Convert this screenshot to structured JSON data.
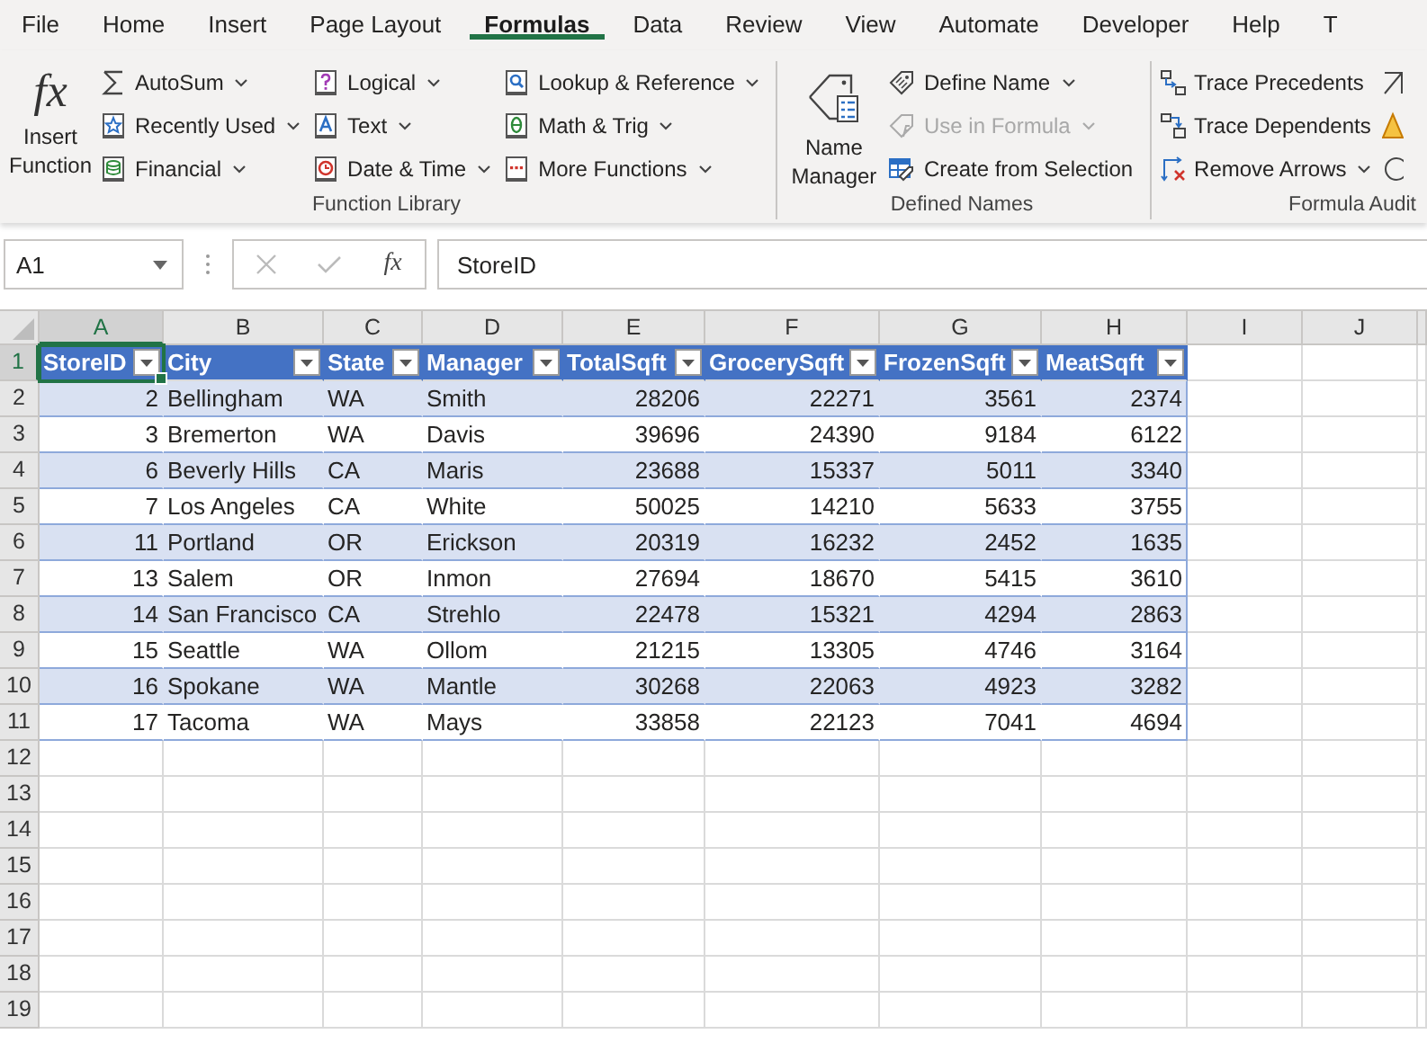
{
  "menu_tabs": [
    {
      "label": "File",
      "selected": false
    },
    {
      "label": "Home",
      "selected": false
    },
    {
      "label": "Insert",
      "selected": false
    },
    {
      "label": "Page Layout",
      "selected": false
    },
    {
      "label": "Formulas",
      "selected": true
    },
    {
      "label": "Data",
      "selected": false
    },
    {
      "label": "Review",
      "selected": false
    },
    {
      "label": "View",
      "selected": false
    },
    {
      "label": "Automate",
      "selected": false
    },
    {
      "label": "Developer",
      "selected": false
    },
    {
      "label": "Help",
      "selected": false
    },
    {
      "label": "T",
      "selected": false
    }
  ],
  "ribbon_groups": [
    {
      "title": "Function Library",
      "large_button": {
        "symbol": "fx",
        "label": "Insert Function"
      },
      "columns": [
        [
          {
            "label": "AutoSum",
            "dropdown": true,
            "disabled": false
          },
          {
            "label": "Recently Used",
            "dropdown": true,
            "disabled": false
          },
          {
            "label": "Financial",
            "dropdown": true,
            "disabled": false
          }
        ],
        [
          {
            "label": "Logical",
            "dropdown": true,
            "disabled": false
          },
          {
            "label": "Text",
            "dropdown": true,
            "disabled": false
          },
          {
            "label": "Date & Time",
            "dropdown": true,
            "disabled": false
          }
        ],
        [
          {
            "label": "Lookup & Reference",
            "dropdown": true,
            "disabled": false
          },
          {
            "label": "Math & Trig",
            "dropdown": true,
            "disabled": false
          },
          {
            "label": "More Functions",
            "dropdown": true,
            "disabled": false
          }
        ]
      ]
    },
    {
      "title": "Defined Names",
      "large_button": {
        "label": "Name Manager"
      },
      "columns": [
        [
          {
            "label": "Define Name",
            "dropdown": true,
            "disabled": false
          },
          {
            "label": "Use in Formula",
            "dropdown": true,
            "disabled": true
          },
          {
            "label": "Create from Selection",
            "dropdown": false,
            "disabled": false
          }
        ]
      ]
    },
    {
      "title": "Formula Audit",
      "columns": [
        [
          {
            "label": "Trace Precedents",
            "dropdown": false,
            "disabled": false
          },
          {
            "label": "Trace Dependents",
            "dropdown": false,
            "disabled": false
          },
          {
            "label": "Remove Arrows",
            "dropdown": true,
            "disabled": false
          }
        ]
      ]
    }
  ],
  "formula_bar": {
    "name_box": "A1",
    "function_symbol": "fx",
    "formula": "StoreID"
  },
  "sheet": {
    "column_headers": [
      {
        "label": "A",
        "selected": true
      },
      {
        "label": "B",
        "selected": false
      },
      {
        "label": "C",
        "selected": false
      },
      {
        "label": "D",
        "selected": false
      },
      {
        "label": "E",
        "selected": false
      },
      {
        "label": "F",
        "selected": false
      },
      {
        "label": "G",
        "selected": false
      },
      {
        "label": "H",
        "selected": false
      },
      {
        "label": "I",
        "selected": false
      },
      {
        "label": "J",
        "selected": false
      }
    ],
    "row_headers": [
      {
        "label": "1",
        "selected": true
      },
      {
        "label": "2",
        "selected": false
      },
      {
        "label": "3",
        "selected": false
      },
      {
        "label": "4",
        "selected": false
      },
      {
        "label": "5",
        "selected": false
      },
      {
        "label": "6",
        "selected": false
      },
      {
        "label": "7",
        "selected": false
      },
      {
        "label": "8",
        "selected": false
      },
      {
        "label": "9",
        "selected": false
      },
      {
        "label": "10",
        "selected": false
      },
      {
        "label": "11",
        "selected": false
      },
      {
        "label": "12",
        "selected": false
      },
      {
        "label": "13",
        "selected": false
      },
      {
        "label": "14",
        "selected": false
      },
      {
        "label": "15",
        "selected": false
      },
      {
        "label": "16",
        "selected": false
      },
      {
        "label": "17",
        "selected": false
      },
      {
        "label": "18",
        "selected": false
      },
      {
        "label": "19",
        "selected": false
      }
    ],
    "table": {
      "columns": [
        {
          "label": "StoreID",
          "kind": "number",
          "selected": true
        },
        {
          "label": "City",
          "kind": "text",
          "selected": false
        },
        {
          "label": "State",
          "kind": "text",
          "selected": false
        },
        {
          "label": "Manager",
          "kind": "text",
          "selected": false
        },
        {
          "label": "TotalSqft",
          "kind": "number",
          "selected": false
        },
        {
          "label": "GrocerySqft",
          "kind": "number",
          "selected": false
        },
        {
          "label": "FrozenSqft",
          "kind": "number",
          "selected": false
        },
        {
          "label": "MeatSqft",
          "kind": "number",
          "selected": false
        }
      ],
      "rows": [
        [
          "2",
          "Bellingham",
          "WA",
          "Smith",
          "28206",
          "22271",
          "3561",
          "2374"
        ],
        [
          "3",
          "Bremerton",
          "WA",
          "Davis",
          "39696",
          "24390",
          "9184",
          "6122"
        ],
        [
          "6",
          "Beverly Hills",
          "CA",
          "Maris",
          "23688",
          "15337",
          "5011",
          "3340"
        ],
        [
          "7",
          "Los Angeles",
          "CA",
          "White",
          "50025",
          "14210",
          "5633",
          "3755"
        ],
        [
          "11",
          "Portland",
          "OR",
          "Erickson",
          "20319",
          "16232",
          "2452",
          "1635"
        ],
        [
          "13",
          "Salem",
          "OR",
          "Inmon",
          "27694",
          "18670",
          "5415",
          "3610"
        ],
        [
          "14",
          "San Francisco",
          "CA",
          "Strehlo",
          "22478",
          "15321",
          "4294",
          "2863"
        ],
        [
          "15",
          "Seattle",
          "WA",
          "Ollom",
          "21215",
          "13305",
          "4746",
          "3164"
        ],
        [
          "16",
          "Spokane",
          "WA",
          "Mantle",
          "30268",
          "22063",
          "4923",
          "3282"
        ],
        [
          "17",
          "Tacoma",
          "WA",
          "Mays",
          "33858",
          "22123",
          "7041",
          "4694"
        ]
      ]
    }
  }
}
